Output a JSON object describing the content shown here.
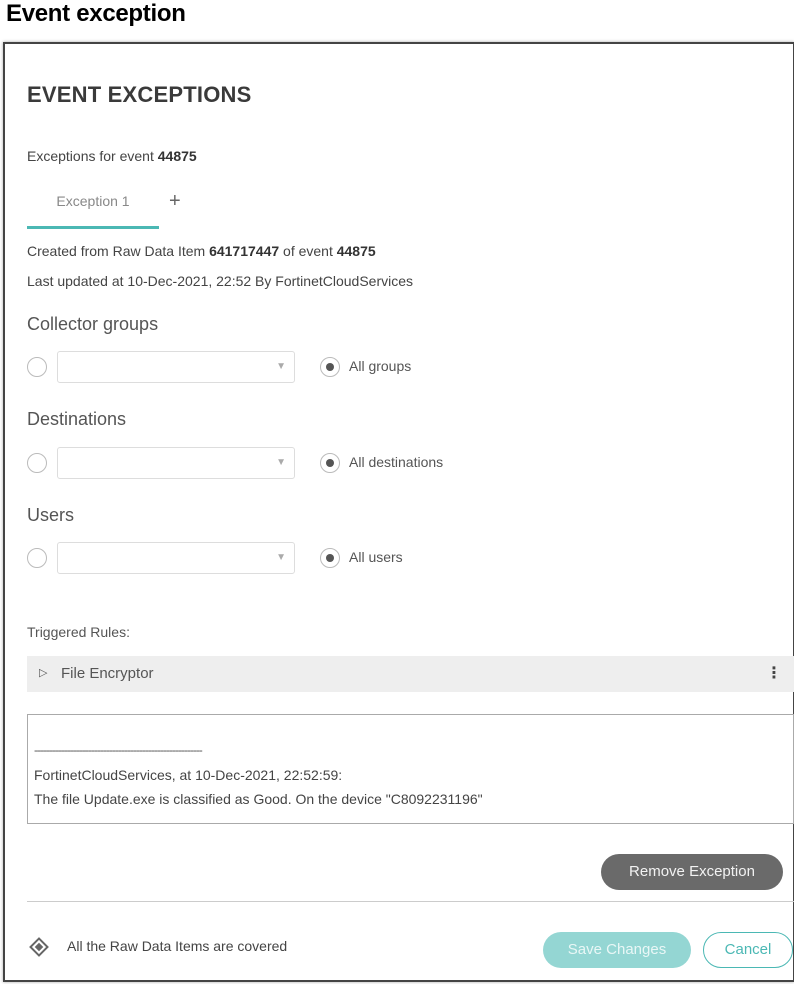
{
  "page": {
    "heading": "Event exception"
  },
  "dialog": {
    "title": "EVENT EXCEPTIONS",
    "exceptions_for_prefix": "Exceptions for event ",
    "event_id": "44875",
    "tabs": [
      {
        "label": "Exception 1",
        "active": true
      }
    ],
    "add_tab_symbol": "+",
    "created_prefix": "Created from Raw Data Item ",
    "raw_data_item": "641717447",
    "created_mid": " of event ",
    "created_event_id": "44875",
    "last_updated": "Last updated at 10-Dec-2021, 22:52 By FortinetCloudServices",
    "sections": {
      "collector_groups": {
        "label": "Collector groups",
        "select_value": "",
        "all_option_label": "All groups",
        "all_selected": true
      },
      "destinations": {
        "label": "Destinations",
        "select_value": "",
        "all_option_label": "All destinations",
        "all_selected": true
      },
      "users": {
        "label": "Users",
        "select_value": "",
        "all_option_label": "All users",
        "all_selected": true
      }
    },
    "triggered_rules_label": "Triggered Rules:",
    "rules": [
      {
        "name": "File Encryptor"
      }
    ],
    "comment": {
      "separator": "--------------------------------------------------------",
      "line1": "FortinetCloudServices, at 10-Dec-2021, 22:52:59:",
      "line2": "The file Update.exe is classified as Good. On the device \"C8092231196\""
    },
    "remove_button": "Remove Exception",
    "covered_text": "All the Raw Data Items are covered",
    "save_button": "Save Changes",
    "cancel_button": "Cancel"
  },
  "colors": {
    "accent": "#4bb8b4",
    "save_disabled": "#94d6d3",
    "remove_button": "#6a6a6a"
  },
  "icons": {
    "add_tab": "plus-icon",
    "dropdown": "chevron-down-icon",
    "rule_expand": "triangle-right-icon",
    "rule_menu": "kebab-menu-icon",
    "covered": "diamond-icon"
  }
}
